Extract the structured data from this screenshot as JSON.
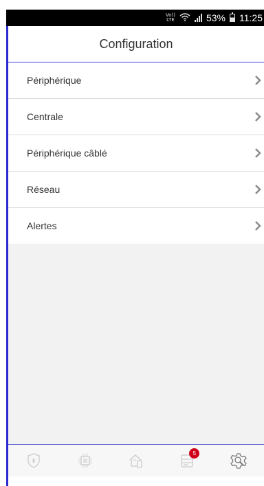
{
  "status_bar": {
    "volte_top": "Vo))",
    "volte_bottom": "LTE",
    "battery_percent": "53%",
    "time": "11:25"
  },
  "header": {
    "title": "Configuration"
  },
  "menu": {
    "items": [
      {
        "label": "Périphérique"
      },
      {
        "label": "Centrale"
      },
      {
        "label": "Périphérique câblé"
      },
      {
        "label": "Réseau"
      },
      {
        "label": "Alertes"
      }
    ]
  },
  "bottom_nav": {
    "badge_count": "5",
    "items": [
      {
        "icon": "shield-icon"
      },
      {
        "icon": "chip-icon"
      },
      {
        "icon": "home-device-icon"
      },
      {
        "icon": "history-icon"
      },
      {
        "icon": "settings-gear-icon"
      }
    ]
  },
  "colors": {
    "accent": "#2a2ad0",
    "badge": "#d0021b",
    "chevron": "#8a8a8a",
    "inactive_icon": "#d0d0d0"
  }
}
